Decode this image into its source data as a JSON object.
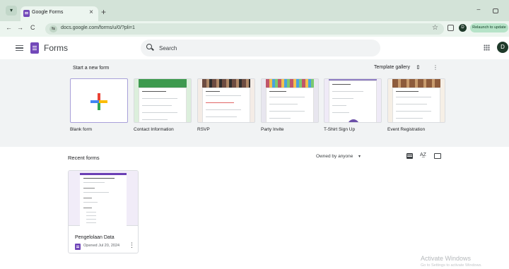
{
  "browser": {
    "tab_title": "Google Forms",
    "tab_close": "×",
    "new_tab": "+",
    "tab_menu": "▾",
    "url": "docs.google.com/forms/u/0/?pli=1",
    "profile_initial": "D",
    "relaunch_label": "Relaunch to update",
    "nav": {
      "back": "←",
      "forward": "→",
      "reload": "C"
    },
    "window_minimize": "−",
    "star": "☆"
  },
  "app": {
    "title": "Forms",
    "search_placeholder": "Search",
    "account_initial": "D"
  },
  "start_section": {
    "title": "Start a new form",
    "gallery_label": "Template gallery",
    "gallery_chevron": "⌃⌄",
    "more": "⋮",
    "templates": [
      {
        "label": "Blank form"
      },
      {
        "label": "Contact Information",
        "header_color": "#3e9a4f"
      },
      {
        "label": "RSVP",
        "header_color": "#6d4c41"
      },
      {
        "label": "Party Invite",
        "header_color": "#c0566a"
      },
      {
        "label": "T-Shirt Sign Up",
        "header_color": "#8e7cc3"
      },
      {
        "label": "Event Registration",
        "header_color": "#8d5b3b"
      }
    ]
  },
  "recent_section": {
    "title": "Recent forms",
    "owner_filter": "Owned by anyone",
    "owner_caret": "▾",
    "sort_icon_text": "A͢Z",
    "documents": [
      {
        "name": "Pengelolaan Data",
        "opened": "Opened Jul 20, 2024",
        "more": "⋮",
        "accent_color": "#6b3fb5"
      }
    ]
  },
  "watermark": {
    "title": "Activate Windows",
    "subtitle": "Go to Settings to activate Windows."
  }
}
